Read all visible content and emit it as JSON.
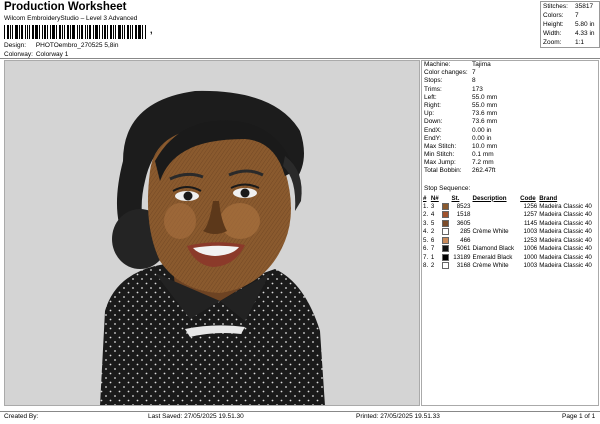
{
  "header": {
    "title": "Production Worksheet",
    "subtitle": "Wilcom EmbroideryStudio – Level 3 Advanced",
    "design_label": "Design:",
    "design_value": "PHOTOembro_270525 5,8in",
    "colorway_label": "Colorway:",
    "colorway_value": "Colorway 1",
    "barcode_suffix": ","
  },
  "top_stats": [
    {
      "key": "Stitches:",
      "value": "35817"
    },
    {
      "key": "Colors:",
      "value": "7"
    },
    {
      "key": "Height:",
      "value": "5.80 in"
    },
    {
      "key": "Width:",
      "value": "4.33 in"
    },
    {
      "key": "Zoom:",
      "value": "1:1"
    }
  ],
  "machine_info": [
    {
      "key": "Machine:",
      "value": "Tajima"
    },
    {
      "key": "Color changes:",
      "value": "7"
    },
    {
      "key": "Stops:",
      "value": "8"
    },
    {
      "key": "Trims:",
      "value": "173"
    },
    {
      "key": "Left:",
      "value": "55.0 mm"
    },
    {
      "key": "Right:",
      "value": "55.0 mm"
    },
    {
      "key": "Up:",
      "value": "73.6 mm"
    },
    {
      "key": "Down:",
      "value": "73.6 mm"
    },
    {
      "key": "EndX:",
      "value": "0.00 in"
    },
    {
      "key": "EndY:",
      "value": "0.00 in"
    },
    {
      "key": "Max Stitch:",
      "value": "10.0 mm"
    },
    {
      "key": "Min Stitch:",
      "value": "0.1 mm"
    },
    {
      "key": "Max Jump:",
      "value": "7.2 mm"
    },
    {
      "key": "Total Bobbin:",
      "value": "262.47ft"
    }
  ],
  "stop_sequence": {
    "label": "Stop Sequence:",
    "headers": [
      "#",
      "N#",
      "St.",
      "Description",
      "Code",
      "Brand"
    ],
    "rows": [
      {
        "num": "1.",
        "n": "3",
        "color": "#8a5a2e",
        "st": "8523",
        "desc": "",
        "code": "1256",
        "brand": "Madeira Classic 40"
      },
      {
        "num": "2.",
        "n": "4",
        "color": "#a0522d",
        "st": "1518",
        "desc": "",
        "code": "1257",
        "brand": "Madeira Classic 40"
      },
      {
        "num": "3.",
        "n": "5",
        "color": "#7b4b2a",
        "st": "3605",
        "desc": "",
        "code": "1145",
        "brand": "Madeira Classic 40"
      },
      {
        "num": "4.",
        "n": "2",
        "color": "#ffffff",
        "st": "285",
        "desc": "Crème White",
        "code": "1003",
        "brand": "Madeira Classic 40"
      },
      {
        "num": "5.",
        "n": "6",
        "color": "#c98a5a",
        "st": "466",
        "desc": "",
        "code": "1253",
        "brand": "Madeira Classic 40"
      },
      {
        "num": "6.",
        "n": "7",
        "color": "#111111",
        "st": "5061",
        "desc": "Diamond Black",
        "code": "1006",
        "brand": "Madeira Classic 40"
      },
      {
        "num": "7.",
        "n": "1",
        "color": "#000000",
        "st": "13189",
        "desc": "Emerald Black",
        "code": "1000",
        "brand": "Madeira Classic 40"
      },
      {
        "num": "8.",
        "n": "2",
        "color": "#ffffff",
        "st": "3168",
        "desc": "Crème White",
        "code": "1003",
        "brand": "Madeira Classic 40"
      }
    ]
  },
  "footer": {
    "created_by": "Created By:",
    "last_saved": "Last Saved: 27/05/2025 19.51.30",
    "printed": "Printed: 27/05/2025 19.51.33",
    "page": "Page 1 of 1"
  }
}
